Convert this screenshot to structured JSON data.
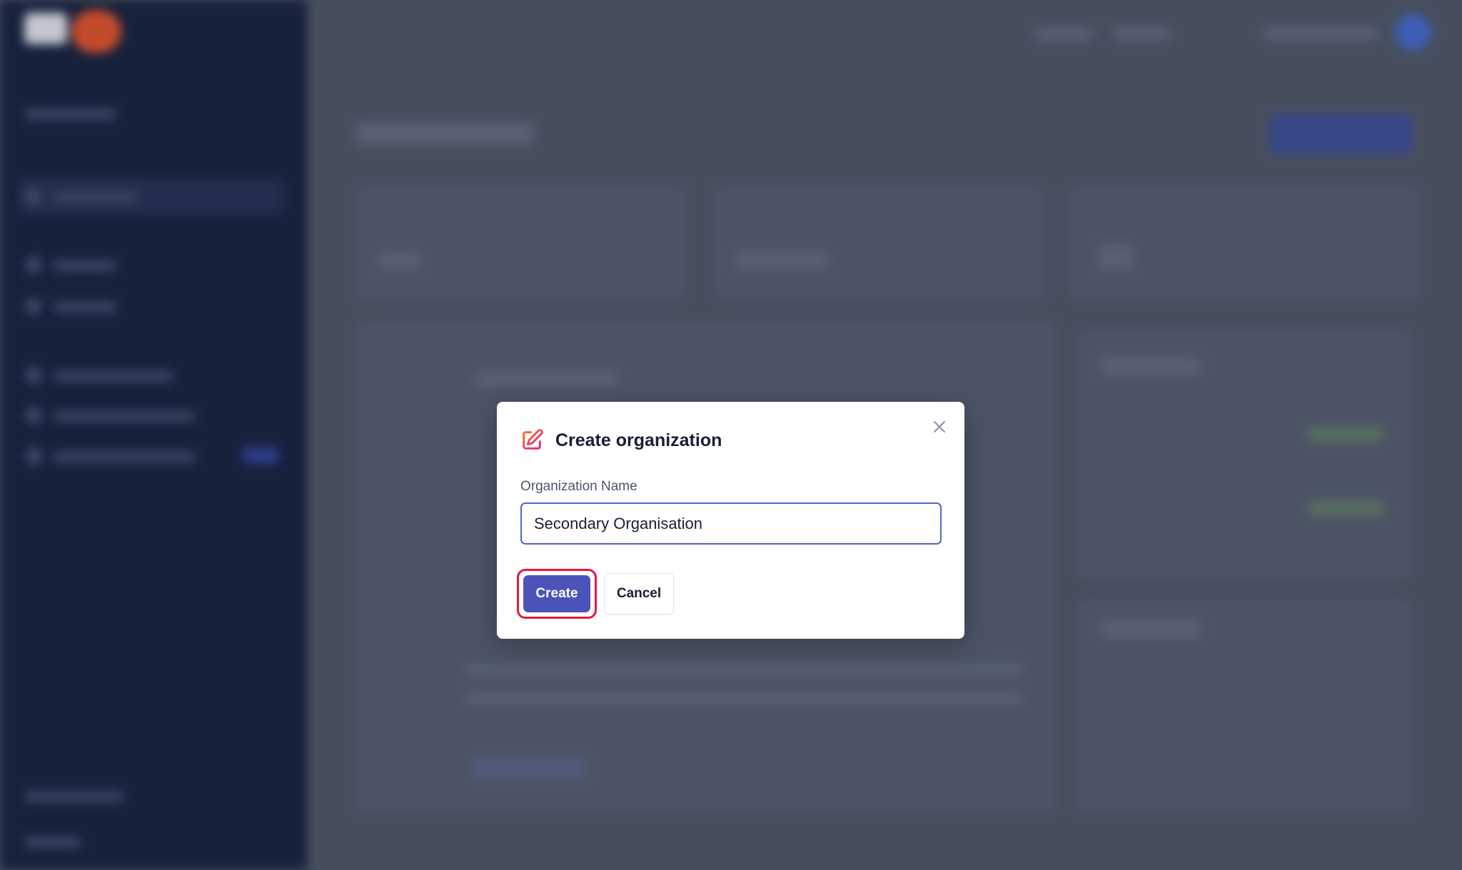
{
  "modal": {
    "title": "Create organization",
    "title_icon": "edit-icon",
    "close_icon": "close-icon",
    "field_label": "Organization Name",
    "field_value": "Secondary Organisation",
    "create_label": "Create",
    "cancel_label": "Cancel"
  },
  "colors": {
    "primary": "#4b53b8",
    "highlight": "#e8173f",
    "icon_gradient_start": "#ff6a2f",
    "icon_gradient_end": "#e6207a"
  }
}
